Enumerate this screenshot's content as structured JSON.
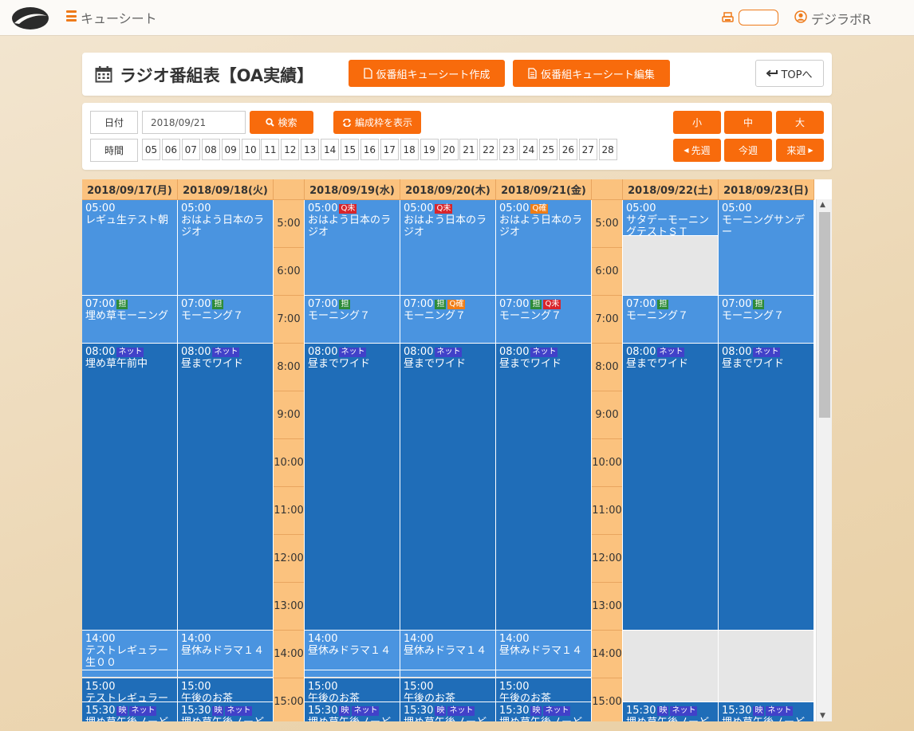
{
  "app": {
    "title": "キューシート",
    "user": "デジラボR"
  },
  "header": {
    "title": "ラジオ番組表【OA実績】",
    "create_btn": "仮番組キューシート作成",
    "edit_btn": "仮番組キューシート編集",
    "top_btn": "TOPへ"
  },
  "controls": {
    "date_label": "日付",
    "date_value": "2018/09/21",
    "search_btn": "検索",
    "frame_btn": "編成枠を表示",
    "time_label": "時間",
    "hours": [
      "05",
      "06",
      "07",
      "08",
      "09",
      "10",
      "11",
      "12",
      "13",
      "14",
      "15",
      "16",
      "17",
      "18",
      "19",
      "20",
      "21",
      "22",
      "23",
      "24",
      "25",
      "26",
      "27",
      "28"
    ],
    "size_small": "小",
    "size_medium": "中",
    "size_large": "大",
    "prev_week": "先週",
    "this_week": "今週",
    "next_week": "来週"
  },
  "days": [
    "2018/09/17(月)",
    "2018/09/18(火)",
    "2018/09/19(水)",
    "2018/09/20(木)",
    "2018/09/21(金)",
    "2018/09/22(土)",
    "2018/09/23(日)"
  ],
  "times": [
    "5:00",
    "6:00",
    "7:00",
    "8:00",
    "9:00",
    "10:00",
    "11:00",
    "12:00",
    "13:00",
    "14:00",
    "15:00"
  ],
  "columns": [
    {
      "day": 0,
      "programs": [
        {
          "time": "05:00",
          "title": "レギュ生テスト朝",
          "badges": [],
          "start": 0,
          "dur": 120,
          "style": "l"
        },
        {
          "time": "07:00",
          "title": "埋め草モーニング",
          "badges": [
            {
              "t": "担",
              "c": "tan"
            }
          ],
          "start": 120,
          "dur": 60,
          "style": "l"
        },
        {
          "time": "08:00",
          "title": "埋め草午前中",
          "badges": [
            {
              "t": "ネット",
              "c": "net"
            }
          ],
          "start": 180,
          "dur": 360,
          "style": "d"
        },
        {
          "time": "14:00",
          "title": "テストレギュラー生００",
          "badges": [],
          "start": 540,
          "dur": 50,
          "style": "l"
        },
        {
          "time": "",
          "title": "",
          "badges": [],
          "start": 590,
          "dur": 10,
          "style": "b"
        },
        {
          "time": "15:00",
          "title": "テストレギュラー収",
          "badges": [],
          "start": 600,
          "dur": 30,
          "style": "d"
        },
        {
          "time": "15:30",
          "title": "埋め草午後ノーど",
          "badges": [
            {
              "t": "映",
              "c": "ei"
            },
            {
              "t": "ネット",
              "c": "net"
            }
          ],
          "start": 630,
          "dur": 30,
          "style": "d"
        }
      ]
    },
    {
      "day": 1,
      "programs": [
        {
          "time": "05:00",
          "title": "おはよう日本のラジオ",
          "badges": [],
          "start": 0,
          "dur": 120,
          "style": "l"
        },
        {
          "time": "07:00",
          "title": "モーニング７",
          "badges": [
            {
              "t": "担",
              "c": "tan"
            }
          ],
          "start": 120,
          "dur": 60,
          "style": "l"
        },
        {
          "time": "08:00",
          "title": "昼までワイド",
          "badges": [
            {
              "t": "ネット",
              "c": "net"
            }
          ],
          "start": 180,
          "dur": 360,
          "style": "d"
        },
        {
          "time": "14:00",
          "title": "昼休みドラマ１４",
          "badges": [],
          "start": 540,
          "dur": 50,
          "style": "l"
        },
        {
          "time": "",
          "title": "",
          "badges": [],
          "start": 590,
          "dur": 10,
          "style": "b"
        },
        {
          "time": "15:00",
          "title": "午後のお茶",
          "badges": [],
          "start": 600,
          "dur": 30,
          "style": "d"
        },
        {
          "time": "15:30",
          "title": "埋め草午後ノーど",
          "badges": [
            {
              "t": "映",
              "c": "ei"
            },
            {
              "t": "ネット",
              "c": "net"
            }
          ],
          "start": 630,
          "dur": 30,
          "style": "d"
        }
      ]
    },
    {
      "day": 2,
      "programs": [
        {
          "time": "05:00",
          "title": "おはよう日本のラジオ",
          "badges": [
            {
              "t": "Q未",
              "c": "qm"
            }
          ],
          "start": 0,
          "dur": 120,
          "style": "l"
        },
        {
          "time": "07:00",
          "title": "モーニング７",
          "badges": [
            {
              "t": "担",
              "c": "tan"
            }
          ],
          "start": 120,
          "dur": 60,
          "style": "l"
        },
        {
          "time": "08:00",
          "title": "昼までワイド",
          "badges": [
            {
              "t": "ネット",
              "c": "net"
            }
          ],
          "start": 180,
          "dur": 360,
          "style": "d"
        },
        {
          "time": "14:00",
          "title": "昼休みドラマ１４",
          "badges": [],
          "start": 540,
          "dur": 50,
          "style": "l"
        },
        {
          "time": "",
          "title": "",
          "badges": [],
          "start": 590,
          "dur": 10,
          "style": "b"
        },
        {
          "time": "15:00",
          "title": "午後のお茶",
          "badges": [],
          "start": 600,
          "dur": 30,
          "style": "d"
        },
        {
          "time": "15:30",
          "title": "埋め草午後ノーど",
          "badges": [
            {
              "t": "映",
              "c": "ei"
            },
            {
              "t": "ネット",
              "c": "net"
            }
          ],
          "start": 630,
          "dur": 30,
          "style": "d"
        }
      ]
    },
    {
      "day": 3,
      "programs": [
        {
          "time": "05:00",
          "title": "おはよう日本のラジオ",
          "badges": [
            {
              "t": "Q未",
              "c": "qm"
            }
          ],
          "start": 0,
          "dur": 120,
          "style": "l"
        },
        {
          "time": "07:00",
          "title": "モーニング７",
          "badges": [
            {
              "t": "担",
              "c": "tan"
            },
            {
              "t": "Q確",
              "c": "qk"
            }
          ],
          "start": 120,
          "dur": 60,
          "style": "l"
        },
        {
          "time": "08:00",
          "title": "昼までワイド",
          "badges": [
            {
              "t": "ネット",
              "c": "net"
            }
          ],
          "start": 180,
          "dur": 360,
          "style": "d"
        },
        {
          "time": "14:00",
          "title": "昼休みドラマ１４",
          "badges": [],
          "start": 540,
          "dur": 50,
          "style": "l"
        },
        {
          "time": "",
          "title": "",
          "badges": [],
          "start": 590,
          "dur": 10,
          "style": "b"
        },
        {
          "time": "15:00",
          "title": "午後のお茶",
          "badges": [],
          "start": 600,
          "dur": 30,
          "style": "d"
        },
        {
          "time": "15:30",
          "title": "埋め草午後ノーど",
          "badges": [
            {
              "t": "映",
              "c": "ei"
            },
            {
              "t": "ネット",
              "c": "net"
            }
          ],
          "start": 630,
          "dur": 30,
          "style": "d"
        }
      ]
    },
    {
      "day": 4,
      "programs": [
        {
          "time": "05:00",
          "title": "おはよう日本のラジオ",
          "badges": [
            {
              "t": "Q確",
              "c": "qk"
            }
          ],
          "start": 0,
          "dur": 120,
          "style": "l"
        },
        {
          "time": "07:00",
          "title": "モーニング７",
          "badges": [
            {
              "t": "担",
              "c": "tan"
            },
            {
              "t": "Q未",
              "c": "qm"
            }
          ],
          "start": 120,
          "dur": 60,
          "style": "l"
        },
        {
          "time": "08:00",
          "title": "昼までワイド",
          "badges": [
            {
              "t": "ネット",
              "c": "net"
            }
          ],
          "start": 180,
          "dur": 360,
          "style": "d"
        },
        {
          "time": "14:00",
          "title": "昼休みドラマ１４",
          "badges": [],
          "start": 540,
          "dur": 50,
          "style": "l"
        },
        {
          "time": "",
          "title": "",
          "badges": [],
          "start": 590,
          "dur": 10,
          "style": "b"
        },
        {
          "time": "15:00",
          "title": "午後のお茶",
          "badges": [],
          "start": 600,
          "dur": 30,
          "style": "d"
        },
        {
          "time": "15:30",
          "title": "埋め草午後ノーど",
          "badges": [
            {
              "t": "映",
              "c": "ei"
            },
            {
              "t": "ネット",
              "c": "net"
            }
          ],
          "start": 630,
          "dur": 30,
          "style": "d"
        }
      ]
    },
    {
      "day": 5,
      "programs": [
        {
          "time": "05:00",
          "title": "サタデーモーニングテストＳＴ",
          "badges": [],
          "start": 0,
          "dur": 45,
          "style": "l"
        },
        {
          "time": "",
          "title": "",
          "badges": [],
          "start": 45,
          "dur": 75,
          "style": "g"
        },
        {
          "time": "07:00",
          "title": "モーニング７",
          "badges": [
            {
              "t": "担",
              "c": "tan"
            }
          ],
          "start": 120,
          "dur": 60,
          "style": "l"
        },
        {
          "time": "08:00",
          "title": "昼までワイド",
          "badges": [
            {
              "t": "ネット",
              "c": "net"
            }
          ],
          "start": 180,
          "dur": 360,
          "style": "d"
        },
        {
          "time": "",
          "title": "",
          "badges": [],
          "start": 540,
          "dur": 90,
          "style": "g"
        },
        {
          "time": "15:30",
          "title": "埋め草午後ノーど",
          "badges": [
            {
              "t": "映",
              "c": "ei"
            },
            {
              "t": "ネット",
              "c": "net"
            }
          ],
          "start": 630,
          "dur": 30,
          "style": "d"
        }
      ]
    },
    {
      "day": 6,
      "programs": [
        {
          "time": "05:00",
          "title": "モーニングサンデー",
          "badges": [],
          "start": 0,
          "dur": 120,
          "style": "l"
        },
        {
          "time": "07:00",
          "title": "モーニング７",
          "badges": [
            {
              "t": "担",
              "c": "tan"
            }
          ],
          "start": 120,
          "dur": 60,
          "style": "l"
        },
        {
          "time": "08:00",
          "title": "昼までワイド",
          "badges": [
            {
              "t": "ネット",
              "c": "net"
            }
          ],
          "start": 180,
          "dur": 360,
          "style": "d"
        },
        {
          "time": "",
          "title": "",
          "badges": [],
          "start": 540,
          "dur": 90,
          "style": "g"
        },
        {
          "time": "15:30",
          "title": "埋め草午後ノーど",
          "badges": [
            {
              "t": "映",
              "c": "ei"
            },
            {
              "t": "ネット",
              "c": "net"
            }
          ],
          "start": 630,
          "dur": 30,
          "style": "d"
        }
      ]
    }
  ]
}
